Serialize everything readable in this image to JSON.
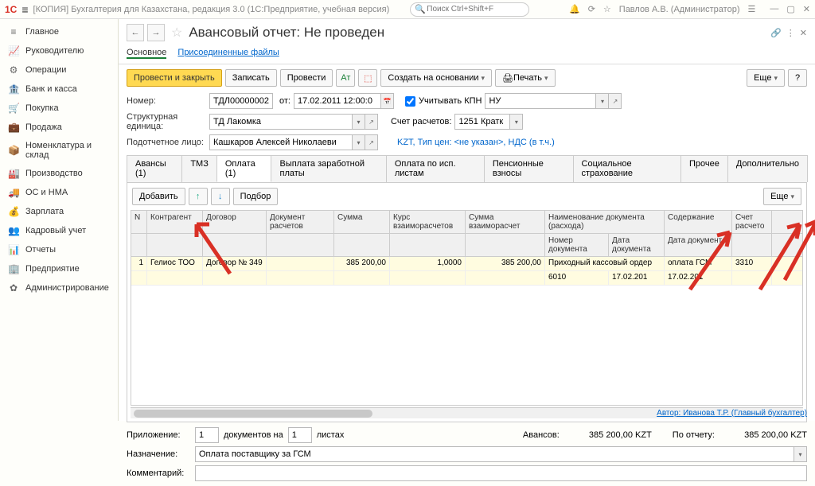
{
  "titlebar": {
    "app_title": "[КОПИЯ] Бухгалтерия для Казахстана, редакция 3.0  (1С:Предприятие, учебная версия)",
    "search_placeholder": "Поиск Ctrl+Shift+F",
    "user": "Павлов А.В. (Администратор)"
  },
  "sidebar": [
    {
      "icon": "≡",
      "label": "Главное"
    },
    {
      "icon": "📈",
      "label": "Руководителю"
    },
    {
      "icon": "⚙",
      "label": "Операции"
    },
    {
      "icon": "🏦",
      "label": "Банк и касса"
    },
    {
      "icon": "🛒",
      "label": "Покупка"
    },
    {
      "icon": "💼",
      "label": "Продажа"
    },
    {
      "icon": "📦",
      "label": "Номенклатура и склад"
    },
    {
      "icon": "🏭",
      "label": "Производство"
    },
    {
      "icon": "🚚",
      "label": "ОС и НМА"
    },
    {
      "icon": "💰",
      "label": "Зарплата"
    },
    {
      "icon": "👥",
      "label": "Кадровый учет"
    },
    {
      "icon": "📊",
      "label": "Отчеты"
    },
    {
      "icon": "🏢",
      "label": "Предприятие"
    },
    {
      "icon": "✿",
      "label": "Администрирование"
    }
  ],
  "doc": {
    "title": "Авансовый отчет: Не проведен",
    "subtab_main": "Основное",
    "subtab_files": "Присоединенные файлы"
  },
  "toolbar": {
    "post_close": "Провести и закрыть",
    "save": "Записать",
    "post": "Провести",
    "create_based": "Создать на основании",
    "print": "Печать",
    "more": "Еще"
  },
  "form": {
    "num_label": "Номер:",
    "num_val": "ТДЛ00000002",
    "date_label": "от:",
    "date_val": "17.02.2011 12:00:0",
    "kpn_label": "Учитывать КПН",
    "kpn_val": "НУ",
    "org_label": "Структурная единица:",
    "org_val": "ТД Лакомка",
    "acc_label": "Счет расчетов:",
    "acc_val": "1251 Кратк",
    "person_label": "Подотчетное лицо:",
    "person_val": "Кашкаров Алексей Николаеви",
    "price_type": "KZT, Тип цен: <не указан>, НДС (в т.ч.)"
  },
  "tabs2": [
    "Авансы (1)",
    "ТМЗ",
    "Оплата (1)",
    "Выплата заработной платы",
    "Оплата по исп. листам",
    "Пенсионные взносы",
    "Социальное страхование",
    "Прочее",
    "Дополнительно"
  ],
  "tabbar": {
    "add": "Добавить",
    "select": "Подбор",
    "more": "Еще"
  },
  "grid": {
    "headers1": [
      "N",
      "Контрагент",
      "Договор",
      "Документ расчетов",
      "Сумма",
      "Курс взаиморасчетов",
      "Сумма взаиморасчет",
      "Наименование документа (расхода)",
      "Содержание",
      "Счет расчето"
    ],
    "headers2": [
      "",
      "",
      "",
      "",
      "",
      "",
      "",
      "Номер документа",
      "Дата документа",
      ""
    ],
    "row1": [
      "1",
      "Гелиос ТОО",
      "Договор № 349",
      "",
      "385 200,00",
      "1,0000",
      "385 200,00",
      "Приходный кассовый ордер",
      "оплата ГСМ",
      "3310"
    ],
    "row2": [
      "",
      "",
      "",
      "",
      "",
      "",
      "",
      "6010",
      "17.02.201",
      ""
    ]
  },
  "bottom": {
    "attach_label": "Приложение:",
    "attach_val": "1",
    "docs_label": "документов на",
    "docs_val": "1",
    "sheets": "листах",
    "advance_label": "Авансов:",
    "advance_val": "385 200,00  KZT",
    "report_label": "По отчету:",
    "report_val": "385 200,00  KZT",
    "purpose_label": "Назначение:",
    "purpose_val": "Оплата поставщику за ГСМ",
    "comment_label": "Комментарий:",
    "author": "Автор: Иванова Т.Р.  (Главный бухгалтер)"
  }
}
